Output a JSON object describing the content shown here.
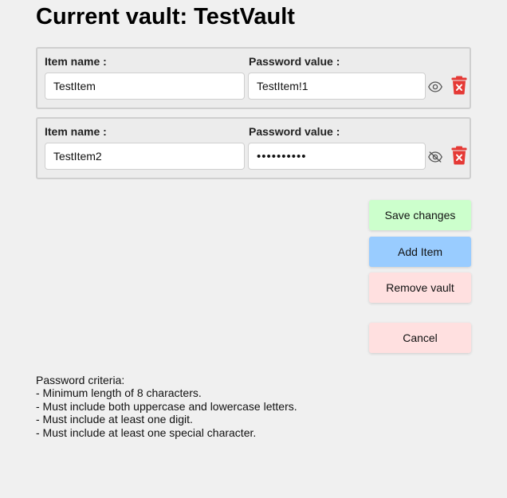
{
  "header": {
    "title_prefix": "Current vault:",
    "vault_name": "TestVault"
  },
  "items": [
    {
      "name_label": "Item name :",
      "name_value": "TestItem",
      "password_label": "Password value :",
      "password_value": "TestItem!1",
      "password_visible": true,
      "toggle_icon": "eye-icon",
      "delete_icon": "trash-icon"
    },
    {
      "name_label": "Item name :",
      "name_value": "TestItem2",
      "password_label": "Password value :",
      "password_value": "••••••••••",
      "password_visible": false,
      "toggle_icon": "eye-off-icon",
      "delete_icon": "trash-icon"
    }
  ],
  "actions": {
    "save_label": "Save changes",
    "add_label": "Add Item",
    "remove_vault_label": "Remove vault",
    "cancel_label": "Cancel"
  },
  "criteria": {
    "heading": "Password criteria:",
    "rules": [
      "- Minimum length of 8 characters.",
      "- Must include both uppercase and lowercase letters.",
      "- Must include at least one digit.",
      "- Must include at least one special character."
    ]
  },
  "colors": {
    "save_button": "#ccffcc",
    "add_button": "#99ccff",
    "remove_vault_button": "#ffe0e0",
    "cancel_button": "#ffe0e0",
    "delete_icon": "#e53935",
    "background": "#f0f0f0"
  }
}
